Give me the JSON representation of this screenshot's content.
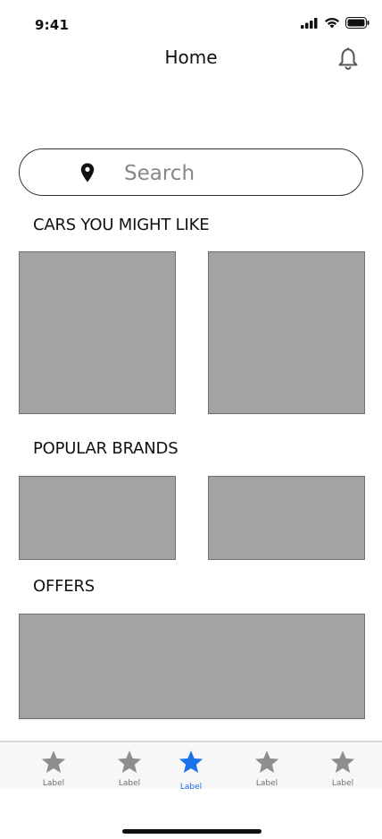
{
  "status_bar": {
    "time": "9:41"
  },
  "header": {
    "title": "Home"
  },
  "search": {
    "placeholder": "Search"
  },
  "sections": {
    "cars": {
      "title": "CARS YOU MIGHT LIKE"
    },
    "brands": {
      "title": "POPULAR BRANDS"
    },
    "offers": {
      "title": "OFFERS"
    }
  },
  "tab_bar": {
    "items": [
      {
        "label": "Label",
        "icon": "star-icon",
        "active": false
      },
      {
        "label": "Label",
        "icon": "star-icon",
        "active": false
      },
      {
        "label": "Label",
        "icon": "star-icon",
        "active": true
      },
      {
        "label": "Label",
        "icon": "star-icon",
        "active": false
      },
      {
        "label": "Label",
        "icon": "star-icon",
        "active": false
      }
    ],
    "active_color": "#1a73e8",
    "inactive_color": "#8e8e8e"
  },
  "colors": {
    "placeholder_tile": "#a3a3a3"
  }
}
